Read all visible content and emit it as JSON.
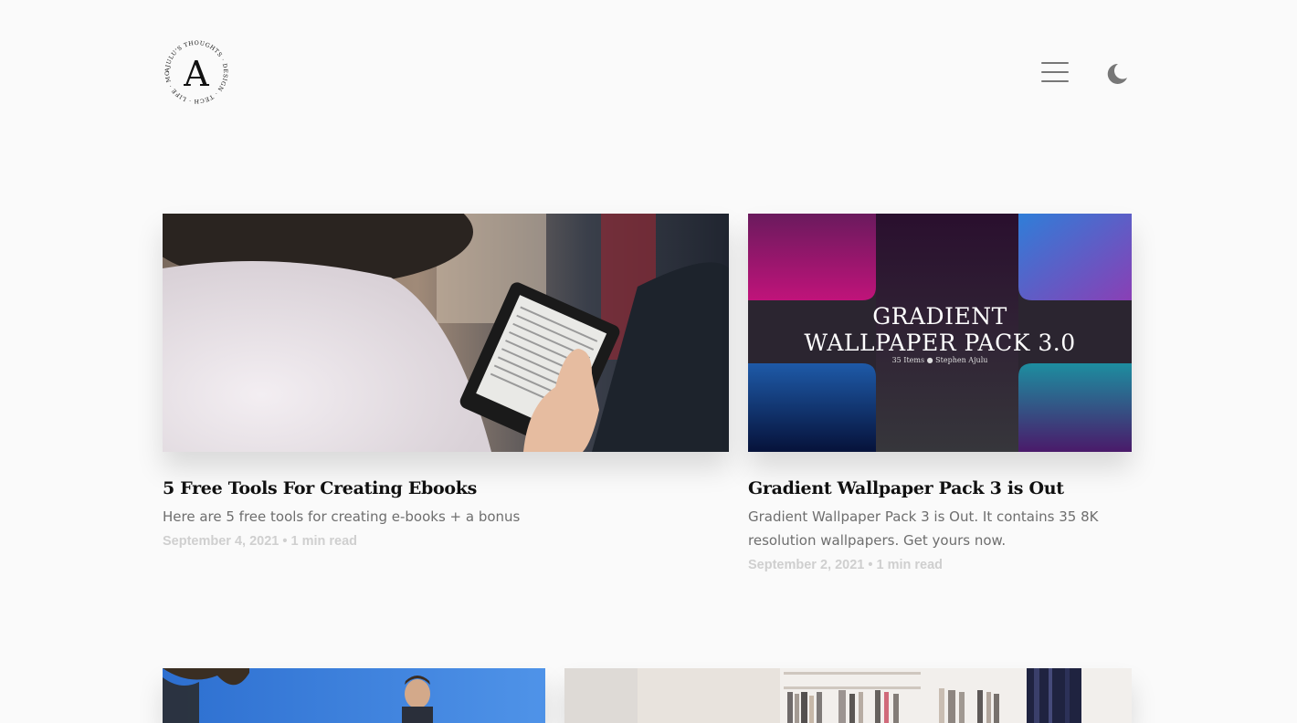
{
  "header": {
    "logo_letter": "A",
    "logo_ring_text": "AJULU'S THOUGHTS · DESIGN · TECH · LIFE · MORE ·"
  },
  "posts": [
    {
      "title": "5 Free Tools For Creating Ebooks",
      "excerpt": "Here are 5 free tools for creating e-books + a bonus",
      "meta": "September 4, 2021 • 1 min read"
    },
    {
      "title": "Gradient Wallpaper Pack 3 is Out",
      "excerpt": "Gradient Wallpaper Pack 3 is Out. It contains 35 8K resolution wallpapers. Get yours now.",
      "meta": "September 2, 2021 • 1 min read",
      "image_title_line1": "GRADIENT",
      "image_title_line2": "WALLPAPER PACK 3.0",
      "image_subtitle": "35 Items ● Stephen Ajulu"
    }
  ],
  "colors": {
    "background": "#fafafa",
    "title": "#111111",
    "excerpt": "#6e6e6e",
    "meta": "#cfcfcf",
    "icon": "#777777"
  }
}
